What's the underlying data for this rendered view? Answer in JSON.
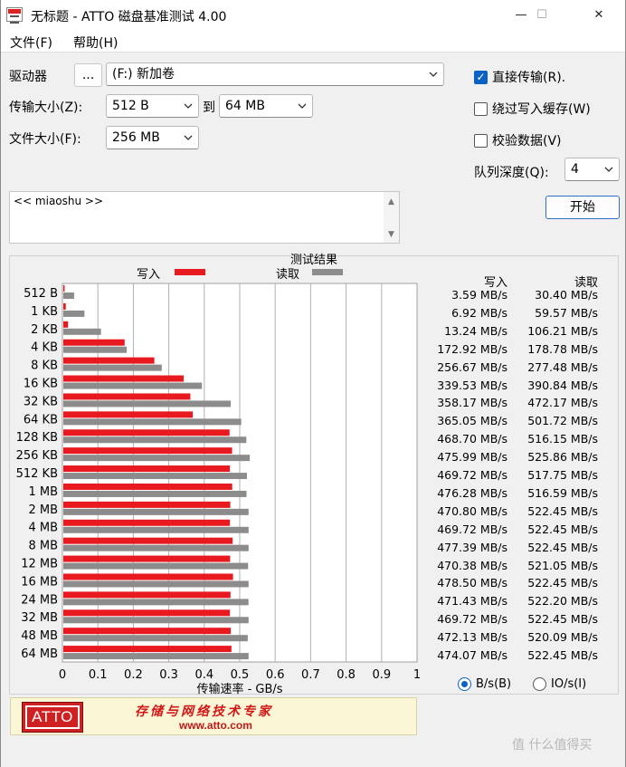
{
  "window": {
    "title": "无标题 - ATTO 磁盘基准测试 4.00",
    "controls": {
      "minimize": "—",
      "maximize": "☐",
      "close": "✕"
    }
  },
  "menu": [
    "文件(F)",
    "帮助(H)"
  ],
  "settings": {
    "drive_label": "驱动器",
    "browse_button": "...",
    "drive_value": "(F:) 新加卷",
    "transfer_size_label": "传输大小(Z):",
    "transfer_from": "512 B",
    "to_label": "到",
    "transfer_to": "64 MB",
    "file_size_label": "文件大小(F):",
    "file_size": "256 MB",
    "direct_io_label": "直接传输(R).",
    "direct_io_checked": true,
    "bypass_cache_label": "绕过写入缓存(W)",
    "bypass_cache_checked": false,
    "verify_label": "校验数据(V)",
    "verify_checked": false,
    "queue_depth_label": "队列深度(Q):",
    "queue_depth": "4",
    "start_button": "开始"
  },
  "notes_text": "<< miaoshu >>",
  "results": {
    "title": "测试结果",
    "legend_write": "写入",
    "legend_read": "读取",
    "write_color": "#e8191f",
    "read_color": "#8c8c8c",
    "col_write": "写入",
    "col_read": "读取",
    "write_values": [
      "3.59 MB/s",
      "6.92 MB/s",
      "13.24 MB/s",
      "172.92 MB/s",
      "256.67 MB/s",
      "339.53 MB/s",
      "358.17 MB/s",
      "365.05 MB/s",
      "468.70 MB/s",
      "475.99 MB/s",
      "469.72 MB/s",
      "476.28 MB/s",
      "470.80 MB/s",
      "469.72 MB/s",
      "477.39 MB/s",
      "470.38 MB/s",
      "478.50 MB/s",
      "471.43 MB/s",
      "469.72 MB/s",
      "472.13 MB/s",
      "474.07 MB/s"
    ],
    "read_values": [
      "30.40 MB/s",
      "59.57 MB/s",
      "106.21 MB/s",
      "178.78 MB/s",
      "277.48 MB/s",
      "390.84 MB/s",
      "472.17 MB/s",
      "501.72 MB/s",
      "516.15 MB/s",
      "525.86 MB/s",
      "517.75 MB/s",
      "516.59 MB/s",
      "522.45 MB/s",
      "522.45 MB/s",
      "522.45 MB/s",
      "521.05 MB/s",
      "522.45 MB/s",
      "522.20 MB/s",
      "522.45 MB/s",
      "520.09 MB/s",
      "522.45 MB/s"
    ]
  },
  "chart_data": {
    "type": "bar",
    "orientation": "horizontal",
    "title": "测试结果",
    "xlabel": "传输速率 - GB/s",
    "xlim": [
      0,
      1
    ],
    "xticks": [
      "0",
      "0.1",
      "0.2",
      "0.3",
      "0.4",
      "0.5",
      "0.6",
      "0.7",
      "0.8",
      "0.9",
      "1"
    ],
    "categories": [
      "512 B",
      "1 KB",
      "2 KB",
      "4 KB",
      "8 KB",
      "16 KB",
      "32 KB",
      "64 KB",
      "128 KB",
      "256 KB",
      "512 KB",
      "1 MB",
      "2 MB",
      "4 MB",
      "8 MB",
      "12 MB",
      "16 MB",
      "24 MB",
      "32 MB",
      "48 MB",
      "64 MB"
    ],
    "series": [
      {
        "name": "写入",
        "values": [
          0.00359,
          0.00692,
          0.01324,
          0.17292,
          0.25667,
          0.33953,
          0.35817,
          0.36505,
          0.4687,
          0.47599,
          0.46972,
          0.47628,
          0.4708,
          0.46972,
          0.47739,
          0.47038,
          0.4785,
          0.47143,
          0.46972,
          0.47213,
          0.47407
        ]
      },
      {
        "name": "读取",
        "values": [
          0.0304,
          0.05957,
          0.10621,
          0.17878,
          0.27748,
          0.39084,
          0.47217,
          0.50172,
          0.51615,
          0.52586,
          0.51775,
          0.51659,
          0.52245,
          0.52245,
          0.52245,
          0.52105,
          0.52245,
          0.5222,
          0.52245,
          0.52009,
          0.52245
        ]
      }
    ],
    "grid": true,
    "legend": "top"
  },
  "units": {
    "bytes_label": "B/s(B)",
    "io_label": "IO/s(I)",
    "selected": "B/s"
  },
  "banner": {
    "logo": "ATTO",
    "slogan": "存储与网络技术专家",
    "url": "www.atto.com"
  },
  "watermark": "值 什么值得买"
}
